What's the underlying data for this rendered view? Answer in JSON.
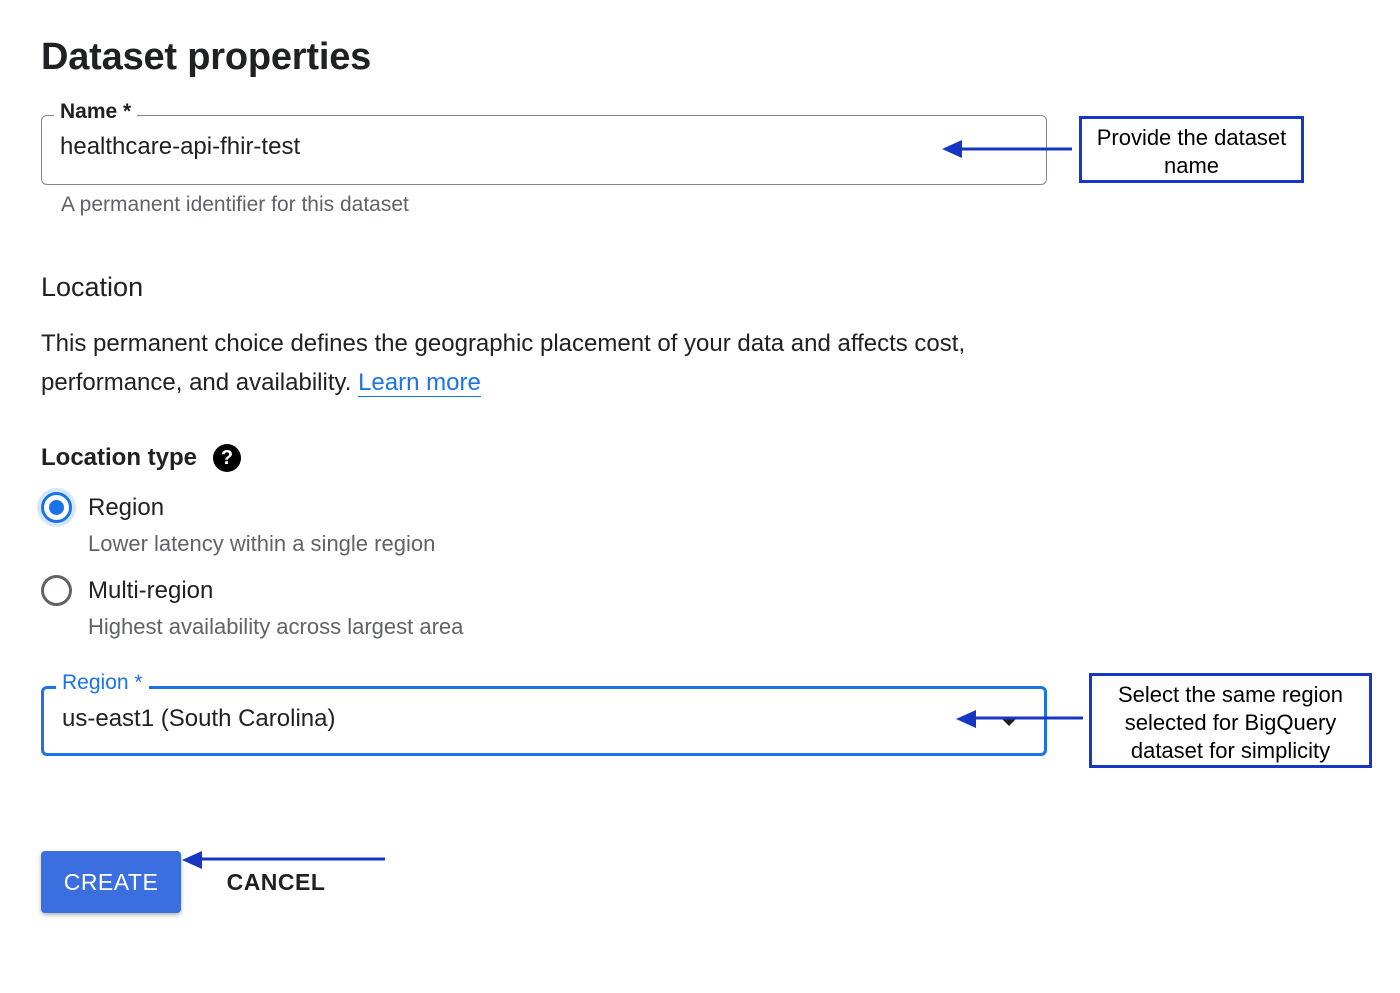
{
  "page": {
    "title": "Dataset properties"
  },
  "name_field": {
    "label": "Name *",
    "value": "healthcare-api-fhir-test",
    "helper": "A permanent identifier for this dataset"
  },
  "location": {
    "title": "Location",
    "description": "This permanent choice defines the geographic placement of your data and affects cost, performance, and availability.",
    "learn_more": "Learn more",
    "type_label": "Location type",
    "help_icon": "?"
  },
  "location_options": [
    {
      "label": "Region",
      "description": "Lower latency within a single region",
      "selected": true
    },
    {
      "label": "Multi-region",
      "description": "Highest availability across largest area",
      "selected": false
    }
  ],
  "region_field": {
    "label": "Region *",
    "value": "us-east1 (South Carolina)"
  },
  "buttons": {
    "create": "CREATE",
    "cancel": "CANCEL"
  },
  "annotations": {
    "name_callout": "Provide the dataset name",
    "region_callout": "Select the same region selected for BigQuery dataset for simplicity"
  },
  "colors": {
    "accent": "#1a73e8",
    "primary_button": "#3b6fe0",
    "annotation": "#1836c4"
  }
}
